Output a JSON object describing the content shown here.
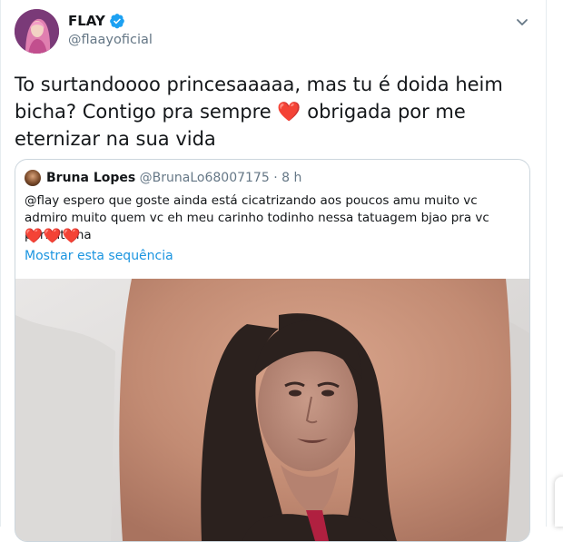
{
  "tweet": {
    "author": {
      "display_name": "FLAY",
      "handle": "@flaayoficial",
      "verified": true
    },
    "text_before_heart": "To surtandoooo princesaaaaa, mas tu é doida heim bicha? Contigo pra sempre ",
    "heart": "❤️",
    "text_after_heart": " obrigada por me eternizar na sua vida",
    "more_icon": "chevron-down-icon"
  },
  "quoted_tweet": {
    "author": {
      "display_name": "Bruna Lopes",
      "handle": "@BrunaLo68007175",
      "separator": "·",
      "time": "8 h"
    },
    "text": "@flay espero que goste ainda está cicatrizando aos poucos amu muito vc admiro muito quem vc eh meu carinho todinho nessa tatuagem bjao pra vc perfeitinha",
    "hearts": "❤️❤️❤️",
    "show_thread_link": "Mostrar esta sequência"
  },
  "colors": {
    "text": "#14171a",
    "secondary": "#657786",
    "link": "#1b95e0",
    "verified": "#1da1f2",
    "heart": "#e0245e",
    "border": "#ccd6dd"
  }
}
